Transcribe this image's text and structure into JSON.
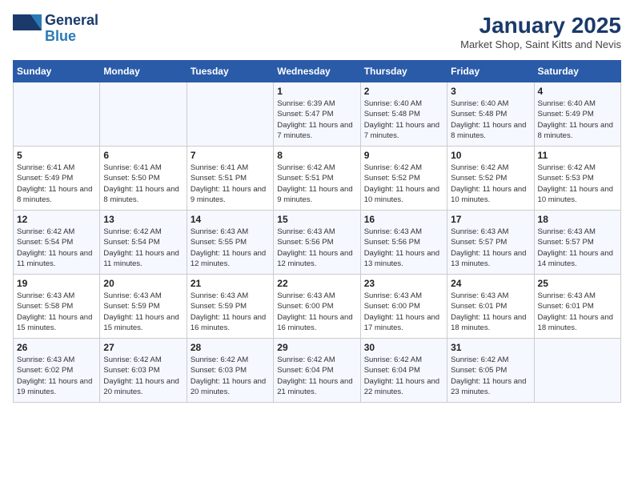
{
  "logo": {
    "general": "General",
    "blue": "Blue"
  },
  "title": "January 2025",
  "subtitle": "Market Shop, Saint Kitts and Nevis",
  "weekdays": [
    "Sunday",
    "Monday",
    "Tuesday",
    "Wednesday",
    "Thursday",
    "Friday",
    "Saturday"
  ],
  "weeks": [
    [
      {
        "day": "",
        "info": ""
      },
      {
        "day": "",
        "info": ""
      },
      {
        "day": "",
        "info": ""
      },
      {
        "day": "1",
        "info": "Sunrise: 6:39 AM\nSunset: 5:47 PM\nDaylight: 11 hours and 7 minutes."
      },
      {
        "day": "2",
        "info": "Sunrise: 6:40 AM\nSunset: 5:48 PM\nDaylight: 11 hours and 7 minutes."
      },
      {
        "day": "3",
        "info": "Sunrise: 6:40 AM\nSunset: 5:48 PM\nDaylight: 11 hours and 8 minutes."
      },
      {
        "day": "4",
        "info": "Sunrise: 6:40 AM\nSunset: 5:49 PM\nDaylight: 11 hours and 8 minutes."
      }
    ],
    [
      {
        "day": "5",
        "info": "Sunrise: 6:41 AM\nSunset: 5:49 PM\nDaylight: 11 hours and 8 minutes."
      },
      {
        "day": "6",
        "info": "Sunrise: 6:41 AM\nSunset: 5:50 PM\nDaylight: 11 hours and 8 minutes."
      },
      {
        "day": "7",
        "info": "Sunrise: 6:41 AM\nSunset: 5:51 PM\nDaylight: 11 hours and 9 minutes."
      },
      {
        "day": "8",
        "info": "Sunrise: 6:42 AM\nSunset: 5:51 PM\nDaylight: 11 hours and 9 minutes."
      },
      {
        "day": "9",
        "info": "Sunrise: 6:42 AM\nSunset: 5:52 PM\nDaylight: 11 hours and 10 minutes."
      },
      {
        "day": "10",
        "info": "Sunrise: 6:42 AM\nSunset: 5:52 PM\nDaylight: 11 hours and 10 minutes."
      },
      {
        "day": "11",
        "info": "Sunrise: 6:42 AM\nSunset: 5:53 PM\nDaylight: 11 hours and 10 minutes."
      }
    ],
    [
      {
        "day": "12",
        "info": "Sunrise: 6:42 AM\nSunset: 5:54 PM\nDaylight: 11 hours and 11 minutes."
      },
      {
        "day": "13",
        "info": "Sunrise: 6:42 AM\nSunset: 5:54 PM\nDaylight: 11 hours and 11 minutes."
      },
      {
        "day": "14",
        "info": "Sunrise: 6:43 AM\nSunset: 5:55 PM\nDaylight: 11 hours and 12 minutes."
      },
      {
        "day": "15",
        "info": "Sunrise: 6:43 AM\nSunset: 5:56 PM\nDaylight: 11 hours and 12 minutes."
      },
      {
        "day": "16",
        "info": "Sunrise: 6:43 AM\nSunset: 5:56 PM\nDaylight: 11 hours and 13 minutes."
      },
      {
        "day": "17",
        "info": "Sunrise: 6:43 AM\nSunset: 5:57 PM\nDaylight: 11 hours and 13 minutes."
      },
      {
        "day": "18",
        "info": "Sunrise: 6:43 AM\nSunset: 5:57 PM\nDaylight: 11 hours and 14 minutes."
      }
    ],
    [
      {
        "day": "19",
        "info": "Sunrise: 6:43 AM\nSunset: 5:58 PM\nDaylight: 11 hours and 15 minutes."
      },
      {
        "day": "20",
        "info": "Sunrise: 6:43 AM\nSunset: 5:59 PM\nDaylight: 11 hours and 15 minutes."
      },
      {
        "day": "21",
        "info": "Sunrise: 6:43 AM\nSunset: 5:59 PM\nDaylight: 11 hours and 16 minutes."
      },
      {
        "day": "22",
        "info": "Sunrise: 6:43 AM\nSunset: 6:00 PM\nDaylight: 11 hours and 16 minutes."
      },
      {
        "day": "23",
        "info": "Sunrise: 6:43 AM\nSunset: 6:00 PM\nDaylight: 11 hours and 17 minutes."
      },
      {
        "day": "24",
        "info": "Sunrise: 6:43 AM\nSunset: 6:01 PM\nDaylight: 11 hours and 18 minutes."
      },
      {
        "day": "25",
        "info": "Sunrise: 6:43 AM\nSunset: 6:01 PM\nDaylight: 11 hours and 18 minutes."
      }
    ],
    [
      {
        "day": "26",
        "info": "Sunrise: 6:43 AM\nSunset: 6:02 PM\nDaylight: 11 hours and 19 minutes."
      },
      {
        "day": "27",
        "info": "Sunrise: 6:42 AM\nSunset: 6:03 PM\nDaylight: 11 hours and 20 minutes."
      },
      {
        "day": "28",
        "info": "Sunrise: 6:42 AM\nSunset: 6:03 PM\nDaylight: 11 hours and 20 minutes."
      },
      {
        "day": "29",
        "info": "Sunrise: 6:42 AM\nSunset: 6:04 PM\nDaylight: 11 hours and 21 minutes."
      },
      {
        "day": "30",
        "info": "Sunrise: 6:42 AM\nSunset: 6:04 PM\nDaylight: 11 hours and 22 minutes."
      },
      {
        "day": "31",
        "info": "Sunrise: 6:42 AM\nSunset: 6:05 PM\nDaylight: 11 hours and 23 minutes."
      },
      {
        "day": "",
        "info": ""
      }
    ]
  ]
}
